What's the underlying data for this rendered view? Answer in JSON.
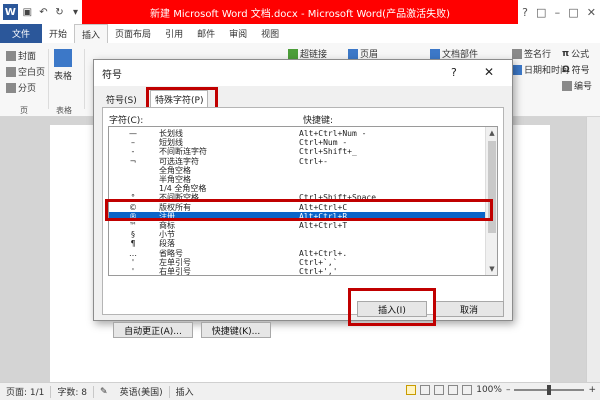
{
  "window": {
    "title": "新建 Microsoft Word 文档.docx - Microsoft Word(产品激活失败)",
    "logo": "W",
    "controls": [
      "?",
      "□",
      "–",
      "□",
      "✕"
    ]
  },
  "ribbon_tabs": [
    "文件",
    "开始",
    "插入",
    "页面布局",
    "引用",
    "邮件",
    "审阅",
    "视图"
  ],
  "ribbon": {
    "cover_page": "封面",
    "blank_page": "空白页",
    "page_break": "分页",
    "group_pages": "页",
    "table": "表格",
    "group_tables": "表格",
    "hyperlink": "超链接",
    "header": "页眉",
    "text_parts": "文档部件",
    "signature_line": "签名行",
    "date_time": "日期和时间",
    "equation": "公式",
    "symbol": "符号",
    "numbering": "编号"
  },
  "dialog": {
    "title": "符号",
    "help": "?",
    "close": "✕",
    "tabs": [
      "符号(S)",
      "特殊字符(P)"
    ],
    "col_char": "字符(C):",
    "col_shortcut": "快捷键:",
    "rows": [
      {
        "sym": "—",
        "name": "长划线",
        "key": "Alt+Ctrl+Num -"
      },
      {
        "sym": "–",
        "name": "短划线",
        "key": "Ctrl+Num -"
      },
      {
        "sym": "-",
        "name": "不间断连字符",
        "key": "Ctrl+Shift+_"
      },
      {
        "sym": "¬",
        "name": "可选连字符",
        "key": "Ctrl+-"
      },
      {
        "sym": "",
        "name": "全角空格",
        "key": ""
      },
      {
        "sym": "",
        "name": "半角空格",
        "key": ""
      },
      {
        "sym": "",
        "name": "1/4 全角空格",
        "key": ""
      },
      {
        "sym": "°",
        "name": "不间断空格",
        "key": "Ctrl+Shift+Space"
      },
      {
        "sym": "©",
        "name": "版权所有",
        "key": "Alt+Ctrl+C"
      },
      {
        "sym": "®",
        "name": "注册",
        "key": "Alt+Ctrl+R"
      },
      {
        "sym": "™",
        "name": "商标",
        "key": "Alt+Ctrl+T"
      },
      {
        "sym": "§",
        "name": "小节",
        "key": ""
      },
      {
        "sym": "¶",
        "name": "段落",
        "key": ""
      },
      {
        "sym": "…",
        "name": "省略号",
        "key": "Alt+Ctrl+."
      },
      {
        "sym": "'",
        "name": "左单引号",
        "key": "Ctrl+`,`"
      },
      {
        "sym": "'",
        "name": "右单引号",
        "key": "Ctrl+','"
      }
    ],
    "selected_index": 9,
    "btn_autocorrect": "自动更正(A)...",
    "btn_shortcut": "快捷键(K)...",
    "btn_insert": "插入(I)",
    "btn_cancel": "取消"
  },
  "statusbar": {
    "page": "页面: 1/1",
    "words": "字数: 8",
    "language": "英语(美国)",
    "mode": "插入",
    "zoom": "100%",
    "minus": "–",
    "plus": "+"
  },
  "colors": {
    "accent_red": "#c00000",
    "word_blue": "#2b579a",
    "selection": "#0a64c8"
  }
}
